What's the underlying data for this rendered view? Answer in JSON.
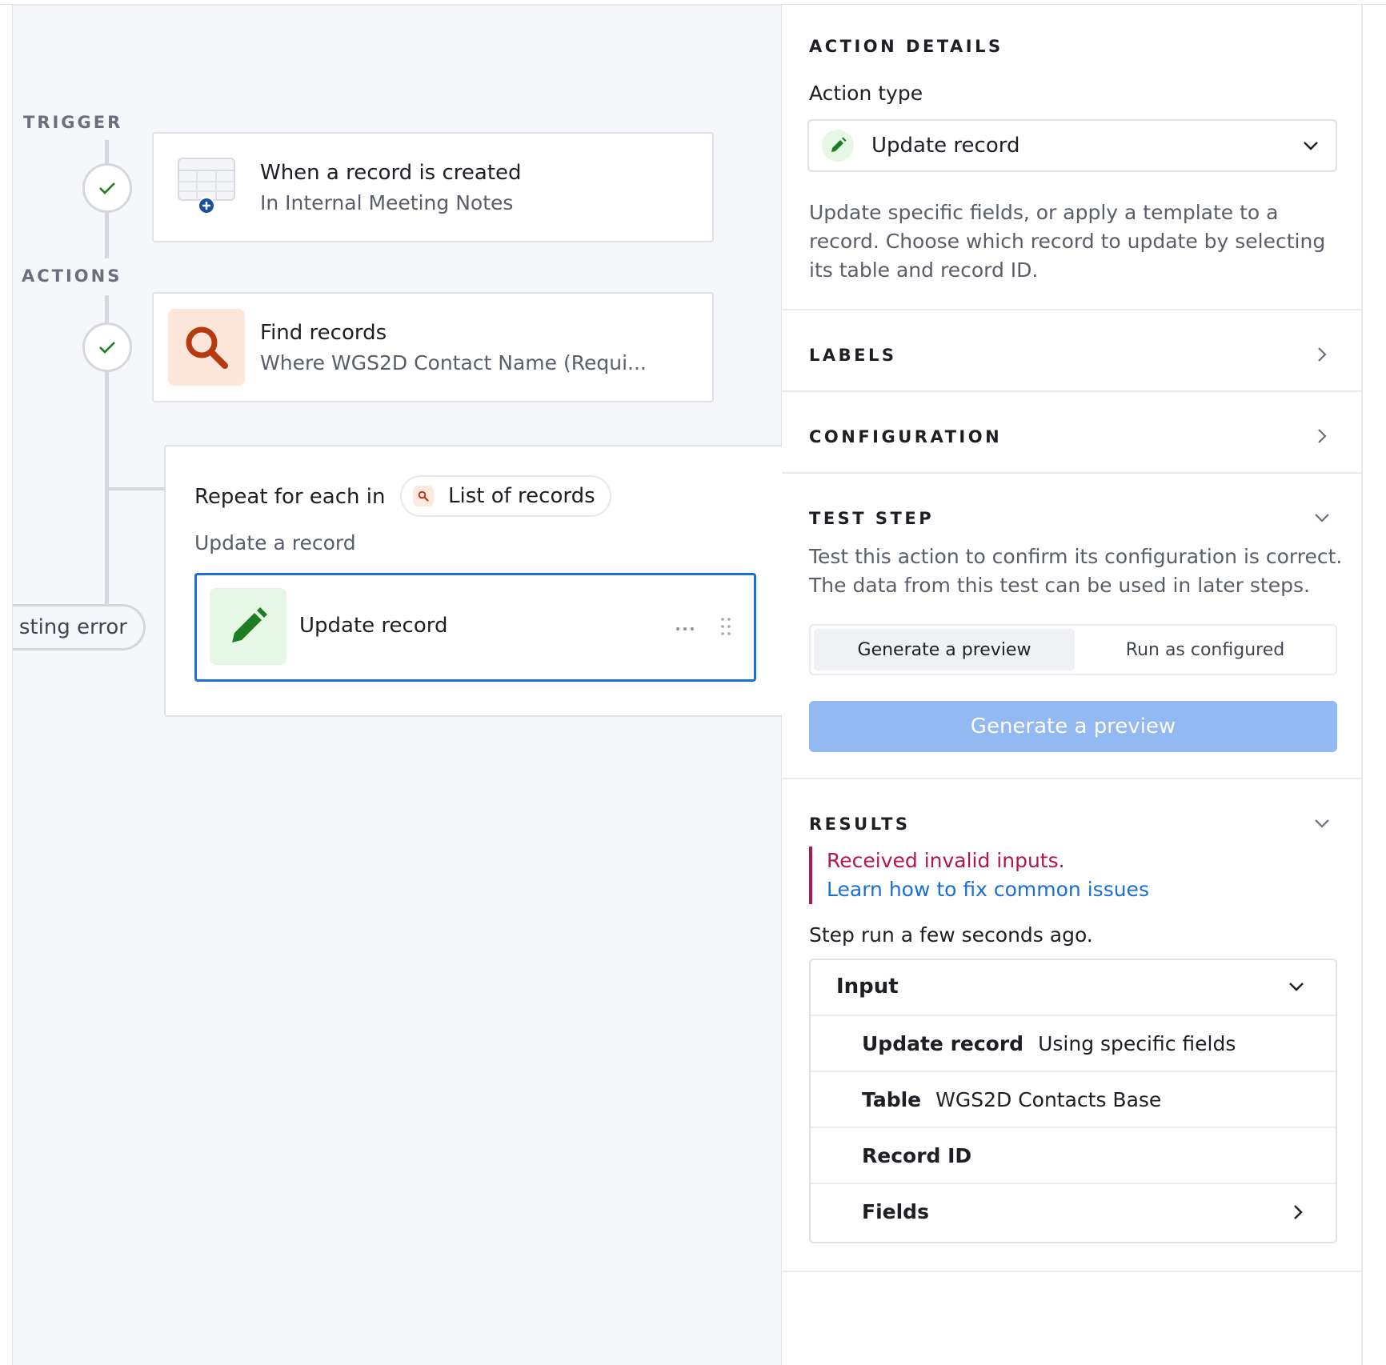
{
  "flow": {
    "trigger_label": "TRIGGER",
    "actions_label": "ACTIONS",
    "error_pill": "sting error",
    "trigger_card": {
      "title": "When a record is created",
      "subtitle": "In Internal Meeting Notes",
      "icon": "table-add-icon"
    },
    "find_card": {
      "title": "Find records",
      "subtitle": "Where WGS2D Contact Name (Requi...",
      "icon": "search-icon"
    },
    "repeat": {
      "title": "Repeat for each in",
      "source_pill": "List of records",
      "subtitle": "Update a record",
      "update_card": {
        "title": "Update record",
        "icon": "pencil-icon"
      }
    }
  },
  "panel": {
    "action_details_heading": "ACTION DETAILS",
    "action_type_label": "Action type",
    "action_type_value": "Update record",
    "action_description": "Update specific fields, or apply a template to a record. Choose which record to update by selecting its table and record ID.",
    "labels_heading": "LABELS",
    "configuration_heading": "CONFIGURATION",
    "test_step_heading": "TEST STEP",
    "test_step_description": "Test this action to confirm its configuration is correct. The data from this test can be used in later steps.",
    "segment": {
      "option_1": "Generate a preview",
      "option_2": "Run as configured"
    },
    "primary_button": "Generate a preview",
    "results_heading": "RESULTS",
    "error_message": "Received invalid inputs.",
    "error_link": "Learn how to fix common issues",
    "step_run_text": "Step run a few seconds ago.",
    "input": {
      "header": "Input",
      "rows": [
        {
          "label": "Update record",
          "value": "Using specific fields"
        },
        {
          "label": "Table",
          "value": "WGS2D Contacts Base"
        },
        {
          "label": "Record ID",
          "value": ""
        },
        {
          "label": "Fields",
          "value": ""
        }
      ]
    }
  },
  "colors": {
    "accent_blue": "#1a6ed8",
    "error_red": "#b3174a",
    "success_green": "#1e7d22",
    "find_orange": "#b53a10",
    "button_disabled_blue": "#92b9f2"
  }
}
